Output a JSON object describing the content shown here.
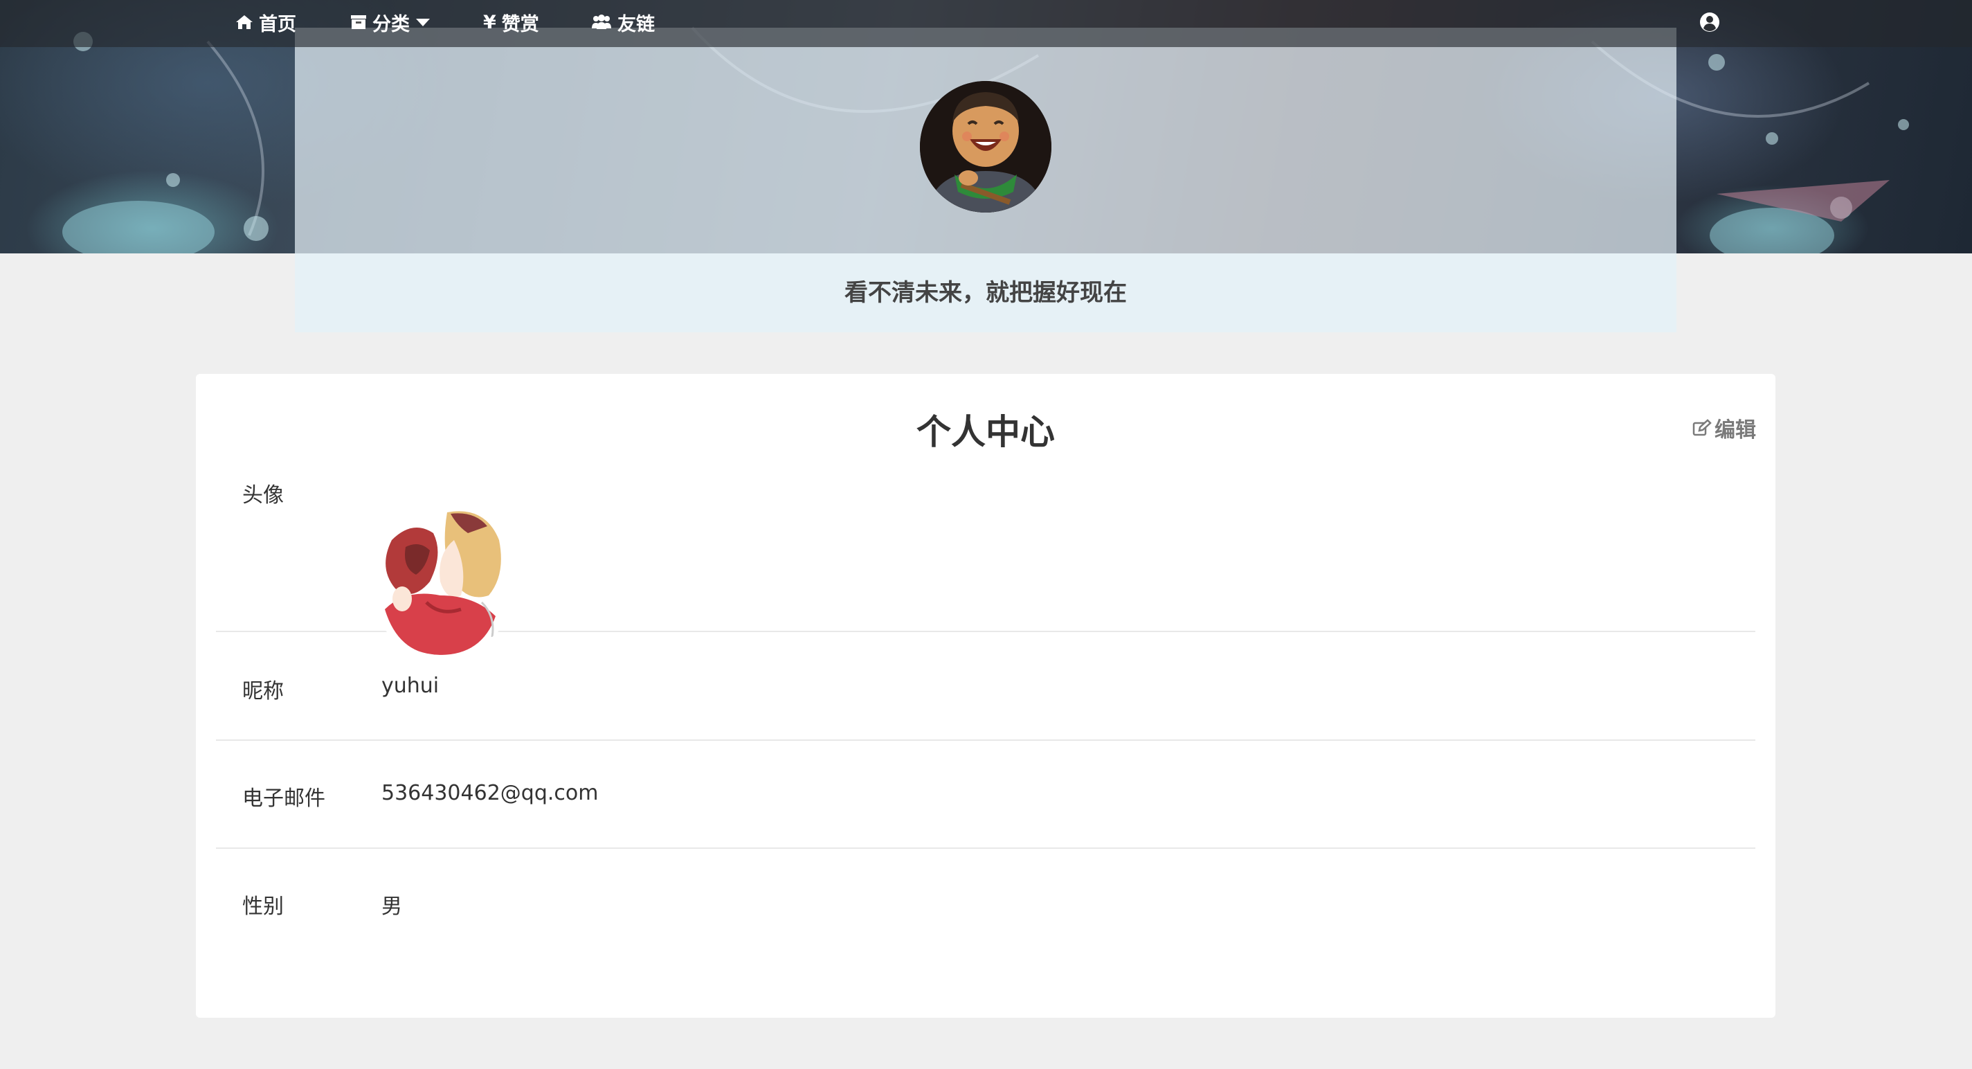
{
  "nav": {
    "home": "首页",
    "category": "分类",
    "reward": "赞赏",
    "reward_symbol": "¥",
    "friend_links": "友链",
    "icons": [
      "home-icon",
      "archive-icon",
      "caret-down-icon",
      "yen-icon",
      "users-icon",
      "user-circle-icon"
    ]
  },
  "hero": {
    "motto": "看不清未来，就把握好现在"
  },
  "profile": {
    "title": "个人中心",
    "edit_label": "编辑",
    "avatar_label": "头像",
    "nickname_label": "昵称",
    "nickname": "yuhui",
    "email_label": "电子邮件",
    "email": "536430462@qq.com",
    "gender_label": "性别",
    "gender": "男"
  },
  "colors": {
    "navbar": "#23262c",
    "page_background": "#efefef",
    "hero_panel": "#e6f1f6",
    "card": "#ffffff",
    "muted_text": "#7a7a7a"
  }
}
